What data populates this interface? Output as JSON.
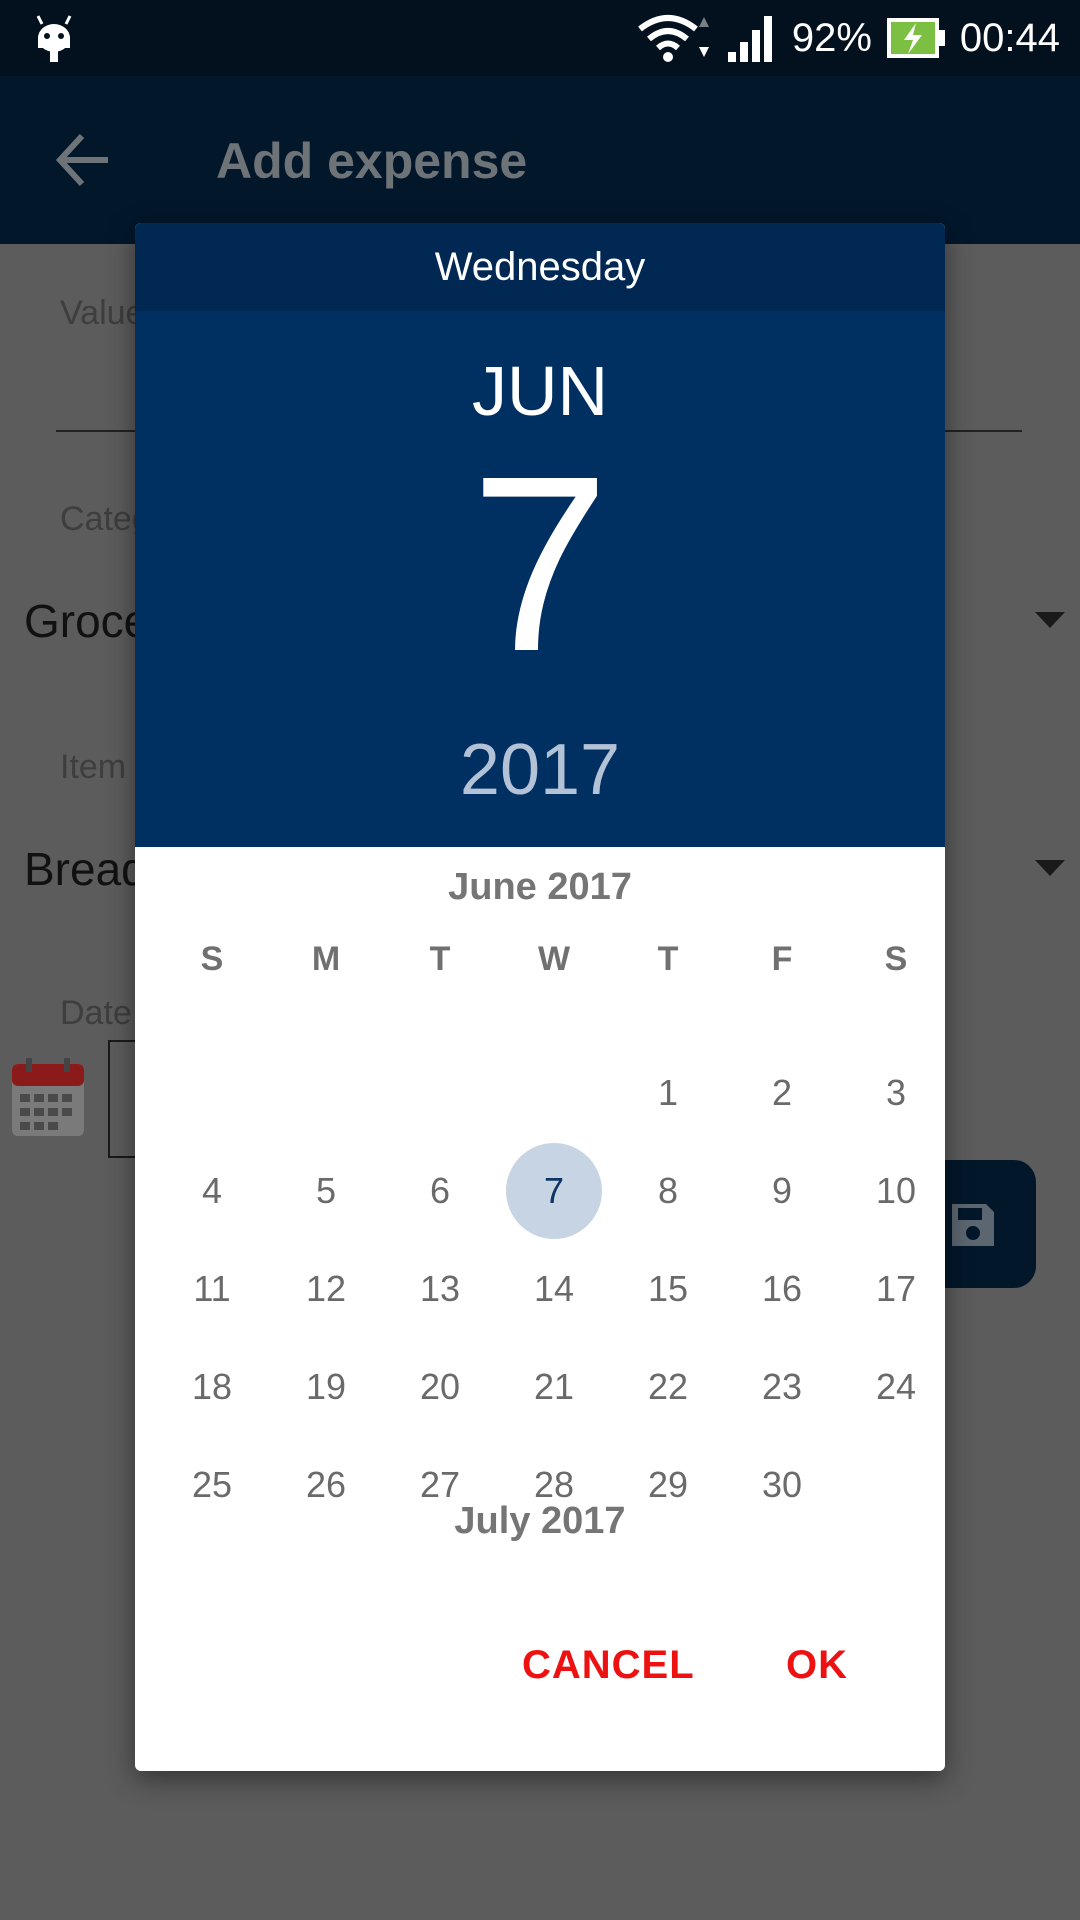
{
  "status_bar": {
    "battery_percent": "92%",
    "time": "00:44"
  },
  "app_bar": {
    "title": "Add expense"
  },
  "form": {
    "value_label": "Value",
    "category_label": "Category",
    "category_value": "Groceries",
    "item_label": "Item",
    "item_value": "Bread",
    "date_label": "Date"
  },
  "date_picker": {
    "weekday": "Wednesday",
    "month_short": "JUN",
    "day": "7",
    "year": "2017",
    "current_month_title": "June 2017",
    "next_month_title": "July 2017",
    "day_of_week_headers": [
      "S",
      "M",
      "T",
      "W",
      "T",
      "F",
      "S"
    ],
    "first_weekday_index": 4,
    "days": [
      "1",
      "2",
      "3",
      "4",
      "5",
      "6",
      "7",
      "8",
      "9",
      "10",
      "11",
      "12",
      "13",
      "14",
      "15",
      "16",
      "17",
      "18",
      "19",
      "20",
      "21",
      "22",
      "23",
      "24",
      "25",
      "26",
      "27",
      "28",
      "29",
      "30"
    ],
    "selected_day": "7",
    "cancel_label": "CANCEL",
    "ok_label": "OK"
  },
  "colors": {
    "header_dark": "#002853",
    "header": "#003062",
    "selected_circle": "#c7d4e3",
    "button_text": "#ee1111",
    "app_bar": "#03172b"
  }
}
